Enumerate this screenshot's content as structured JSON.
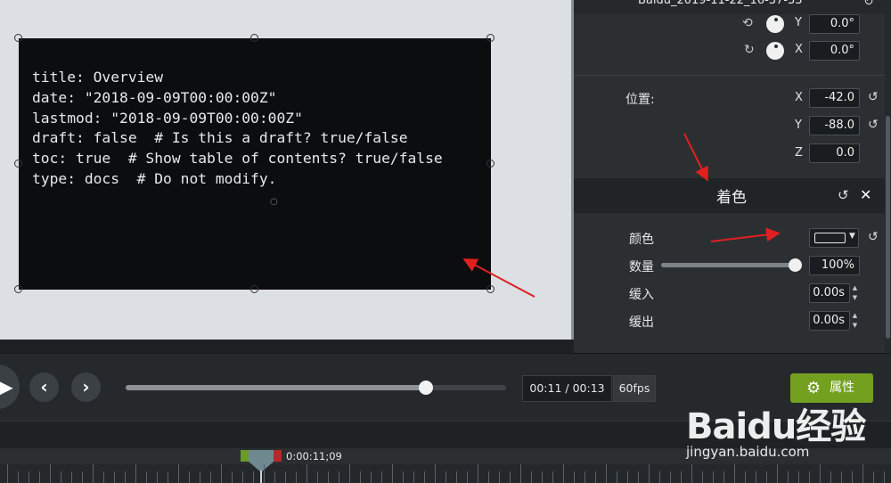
{
  "canvas": {
    "code_text": "title: Overview\ndate: \"2018-09-09T00:00:00Z\"\nlastmod: \"2018-09-09T00:00:00Z\"\ndraft: false  # Is this a draft? true/false\ntoc: true  # Show table of contents? true/false\ntype: docs  # Do not modify."
  },
  "properties": {
    "clip_title": "Baidu_2019-11-22_16-37-33",
    "rotation": [
      {
        "axis": "Y",
        "value": "0.0°"
      },
      {
        "axis": "X",
        "value": "0.0°"
      }
    ],
    "position": {
      "label": "位置:",
      "x": {
        "axis": "X",
        "value": "-42.0"
      },
      "y": {
        "axis": "Y",
        "value": "-88.0"
      },
      "z": {
        "axis": "Z",
        "value": "0.0"
      }
    },
    "colorize": {
      "title": "着色",
      "color_label": "颜色",
      "amount_label": "数量",
      "amount_value": "100%",
      "amount_fraction": 1.0,
      "ease_in_label": "缓入",
      "ease_in_value": "0.00s",
      "ease_out_label": "缓出",
      "ease_out_value": "0.00s"
    }
  },
  "playback": {
    "time": "00:11 / 00:13",
    "fps": "60fps",
    "progress_fraction": 0.79,
    "properties_button": "属性"
  },
  "timeline": {
    "playhead_time": "0:00:11;09"
  },
  "watermark": {
    "logo": "Baidu经验",
    "url": "jingyan.baidu.com"
  },
  "colors": {
    "accent_green": "#74a01f",
    "annotation_red": "#e02020"
  }
}
